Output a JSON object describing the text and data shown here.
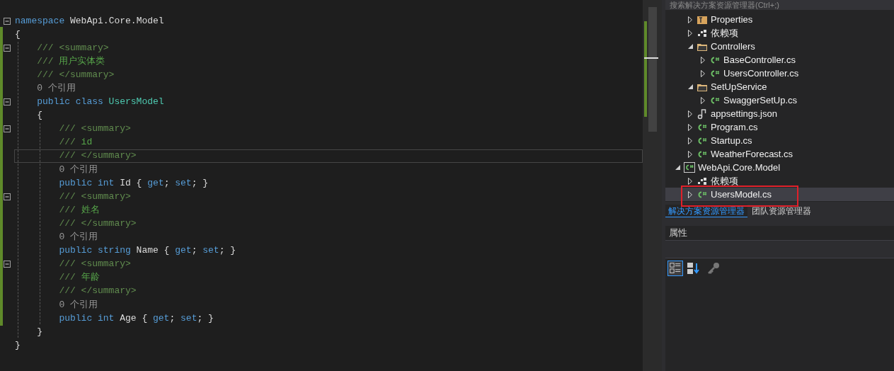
{
  "editor": {
    "lines": [
      {
        "fold": true,
        "current": false,
        "tokens": [
          {
            "kind": "keyword",
            "text": "namespace"
          },
          {
            "kind": "plain",
            "text": " WebApi.Core.Model"
          }
        ]
      },
      {
        "fold": false,
        "current": false,
        "tokens": [
          {
            "kind": "plain",
            "text": "{"
          }
        ],
        "children": [
          {
            "fold": true,
            "current": false,
            "tokens": [
              {
                "kind": "doc",
                "text": "///"
              },
              {
                "kind": "doc",
                "text": " <summary>"
              }
            ]
          },
          {
            "fold": false,
            "current": false,
            "tokens": [
              {
                "kind": "doc",
                "text": "///"
              },
              {
                "kind": "comment",
                "text": " 用户实体类"
              }
            ]
          },
          {
            "fold": false,
            "current": false,
            "tokens": [
              {
                "kind": "doc",
                "text": "///"
              },
              {
                "kind": "doc",
                "text": " </summary>"
              }
            ]
          },
          {
            "fold": false,
            "current": false,
            "tokens": [
              {
                "kind": "codelens",
                "text": "0 个引用"
              }
            ]
          },
          {
            "fold": true,
            "current": false,
            "tokens": [
              {
                "kind": "keyword",
                "text": "public"
              },
              {
                "kind": "keyword",
                "text": " class"
              },
              {
                "kind": "type",
                "text": " UsersModel"
              }
            ]
          },
          {
            "fold": false,
            "current": false,
            "tokens": [
              {
                "kind": "plain",
                "text": "{"
              }
            ],
            "children": [
              {
                "fold": true,
                "current": false,
                "tokens": [
                  {
                    "kind": "doc",
                    "text": "///"
                  },
                  {
                    "kind": "doc",
                    "text": " <summary>"
                  }
                ]
              },
              {
                "fold": false,
                "current": false,
                "tokens": [
                  {
                    "kind": "doc",
                    "text": "///"
                  },
                  {
                    "kind": "comment",
                    "text": " id"
                  }
                ]
              },
              {
                "fold": false,
                "current": true,
                "tokens": [
                  {
                    "kind": "doc",
                    "text": "///"
                  },
                  {
                    "kind": "doc",
                    "text": " </summary>"
                  }
                ]
              },
              {
                "fold": false,
                "current": false,
                "tokens": [
                  {
                    "kind": "codelens",
                    "text": "0 个引用"
                  }
                ]
              },
              {
                "fold": false,
                "current": false,
                "tokens": [
                  {
                    "kind": "keyword",
                    "text": "public"
                  },
                  {
                    "kind": "keyword",
                    "text": " int"
                  },
                  {
                    "kind": "plain",
                    "text": " Id { "
                  },
                  {
                    "kind": "keyword",
                    "text": "get"
                  },
                  {
                    "kind": "plain",
                    "text": "; "
                  },
                  {
                    "kind": "keyword",
                    "text": "set"
                  },
                  {
                    "kind": "plain",
                    "text": "; }"
                  }
                ]
              },
              {
                "fold": true,
                "current": false,
                "tokens": [
                  {
                    "kind": "doc",
                    "text": "///"
                  },
                  {
                    "kind": "doc",
                    "text": " <summary>"
                  }
                ]
              },
              {
                "fold": false,
                "current": false,
                "tokens": [
                  {
                    "kind": "doc",
                    "text": "///"
                  },
                  {
                    "kind": "comment",
                    "text": " 姓名"
                  }
                ]
              },
              {
                "fold": false,
                "current": false,
                "tokens": [
                  {
                    "kind": "doc",
                    "text": "///"
                  },
                  {
                    "kind": "doc",
                    "text": " </summary>"
                  }
                ]
              },
              {
                "fold": false,
                "current": false,
                "tokens": [
                  {
                    "kind": "codelens",
                    "text": "0 个引用"
                  }
                ]
              },
              {
                "fold": false,
                "current": false,
                "tokens": [
                  {
                    "kind": "keyword",
                    "text": "public"
                  },
                  {
                    "kind": "keyword",
                    "text": " string"
                  },
                  {
                    "kind": "plain",
                    "text": " Name { "
                  },
                  {
                    "kind": "keyword",
                    "text": "get"
                  },
                  {
                    "kind": "plain",
                    "text": "; "
                  },
                  {
                    "kind": "keyword",
                    "text": "set"
                  },
                  {
                    "kind": "plain",
                    "text": "; }"
                  }
                ]
              },
              {
                "fold": true,
                "current": false,
                "tokens": [
                  {
                    "kind": "doc",
                    "text": "///"
                  },
                  {
                    "kind": "doc",
                    "text": " <summary>"
                  }
                ]
              },
              {
                "fold": false,
                "current": false,
                "tokens": [
                  {
                    "kind": "doc",
                    "text": "///"
                  },
                  {
                    "kind": "comment",
                    "text": " 年龄"
                  }
                ]
              },
              {
                "fold": false,
                "current": false,
                "tokens": [
                  {
                    "kind": "doc",
                    "text": "///"
                  },
                  {
                    "kind": "doc",
                    "text": " </summary>"
                  }
                ]
              },
              {
                "fold": false,
                "current": false,
                "tokens": [
                  {
                    "kind": "codelens",
                    "text": "0 个引用"
                  }
                ]
              },
              {
                "fold": false,
                "current": false,
                "tokens": [
                  {
                    "kind": "keyword",
                    "text": "public"
                  },
                  {
                    "kind": "keyword",
                    "text": " int"
                  },
                  {
                    "kind": "plain",
                    "text": " Age { "
                  },
                  {
                    "kind": "keyword",
                    "text": "get"
                  },
                  {
                    "kind": "plain",
                    "text": "; "
                  },
                  {
                    "kind": "keyword",
                    "text": "set"
                  },
                  {
                    "kind": "plain",
                    "text": "; }"
                  }
                ]
              }
            ]
          },
          {
            "fold": false,
            "current": false,
            "tokens": [
              {
                "kind": "plain",
                "text": "}"
              }
            ]
          }
        ]
      },
      {
        "fold": false,
        "current": false,
        "tokens": [
          {
            "kind": "plain",
            "text": "}"
          }
        ]
      }
    ]
  },
  "solution_explorer": {
    "search": {
      "placeholder": "搜索解决方案资源管理器(Ctrl+;)"
    },
    "items": [
      {
        "label": "Properties",
        "kind": "properties",
        "expanded": false,
        "selected": false,
        "annotated": false
      },
      {
        "label": "依赖项",
        "kind": "references",
        "expanded": false,
        "selected": false,
        "annotated": false
      },
      {
        "label": "Controllers",
        "kind": "folder",
        "expanded": true,
        "selected": false,
        "annotated": false,
        "children": [
          {
            "label": "BaseController.cs",
            "kind": "csharp",
            "expanded": false,
            "selected": false,
            "annotated": false
          },
          {
            "label": "UsersController.cs",
            "kind": "csharp",
            "expanded": false,
            "selected": false,
            "annotated": false
          }
        ]
      },
      {
        "label": "SetUpService",
        "kind": "folder",
        "expanded": true,
        "selected": false,
        "annotated": false,
        "children": [
          {
            "label": "SwaggerSetUp.cs",
            "kind": "csharp",
            "expanded": false,
            "selected": false,
            "annotated": false
          }
        ]
      },
      {
        "label": "appsettings.json",
        "kind": "json",
        "expanded": false,
        "selected": false,
        "annotated": false
      },
      {
        "label": "Program.cs",
        "kind": "csharp",
        "expanded": false,
        "selected": false,
        "annotated": false
      },
      {
        "label": "Startup.cs",
        "kind": "csharp",
        "expanded": false,
        "selected": false,
        "annotated": false
      },
      {
        "label": "WeatherForecast.cs",
        "kind": "csharp",
        "expanded": false,
        "selected": false,
        "annotated": false
      }
    ],
    "projects": [
      {
        "label": "WebApi.Core.Model",
        "kind": "project",
        "expanded": true,
        "selected": false,
        "annotated": false,
        "children": [
          {
            "label": "依赖项",
            "kind": "references",
            "expanded": false,
            "selected": false,
            "annotated": false
          },
          {
            "label": "UsersModel.cs",
            "kind": "csharp",
            "expanded": false,
            "selected": true,
            "annotated": true
          }
        ]
      }
    ]
  },
  "tabs": [
    {
      "label": "解决方案资源管理器",
      "selected": true
    },
    {
      "label": "团队资源管理器",
      "selected": false
    }
  ],
  "properties": {
    "title": "属性"
  }
}
